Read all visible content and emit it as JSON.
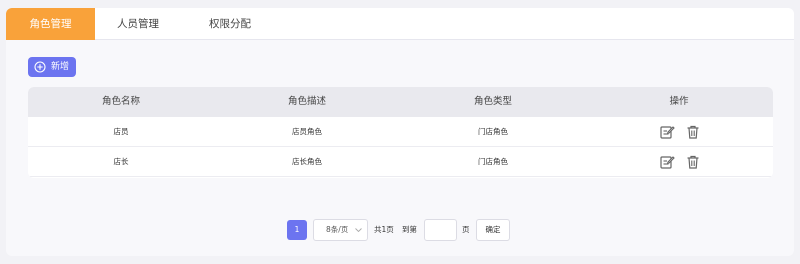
{
  "tabs": [
    {
      "label": "角色管理",
      "active": true
    },
    {
      "label": "人员管理",
      "active": false
    },
    {
      "label": "权限分配",
      "active": false
    }
  ],
  "toolbar": {
    "add_label": "新增",
    "add_icon": "plus-circle-icon"
  },
  "table": {
    "columns": [
      "角色名称",
      "角色描述",
      "角色类型",
      "操作"
    ],
    "rows": [
      {
        "name": "店员",
        "description": "店员角色",
        "type": "门店角色"
      },
      {
        "name": "店长",
        "description": "店长角色",
        "type": "门店角色"
      }
    ],
    "action_icons": [
      "edit-icon",
      "trash-icon"
    ]
  },
  "pagination": {
    "current_page": "1",
    "page_size": "8条/页",
    "total": "共1页",
    "goto_label": "到第",
    "goto_value": "",
    "page_unit": "页",
    "confirm_label": "确定"
  },
  "colors": {
    "accent": "#f9a23a",
    "primary": "#6c74f0"
  }
}
